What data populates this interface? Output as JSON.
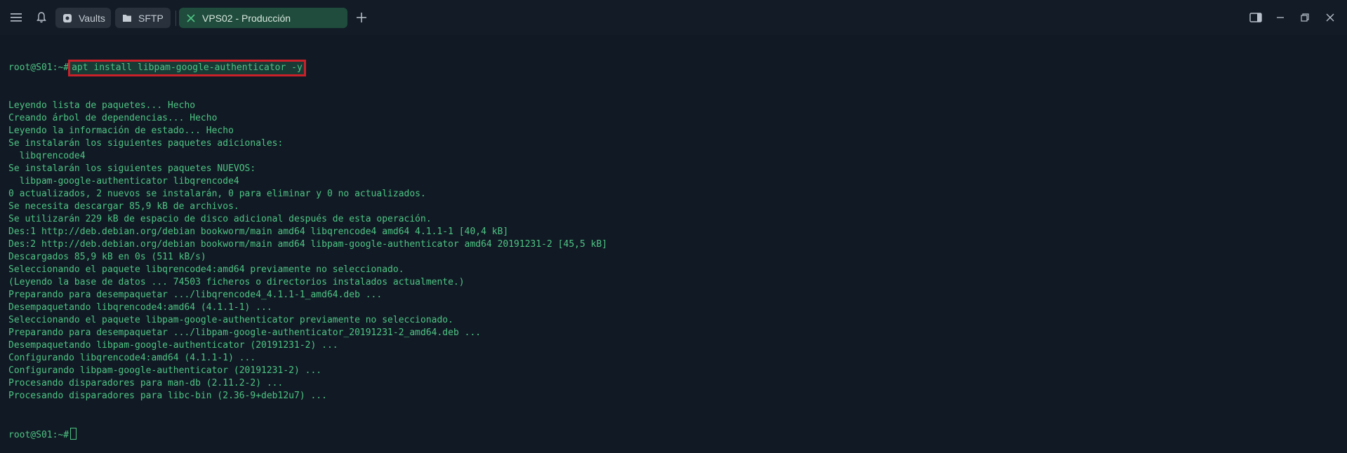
{
  "tabs": {
    "vaults": "Vaults",
    "sftp": "SFTP",
    "active": "VPS02 - Producción"
  },
  "terminal": {
    "prompt": "root@S01:~#",
    "command": "apt install libpam-google-authenticator -y",
    "output": [
      "Leyendo lista de paquetes... Hecho",
      "Creando árbol de dependencias... Hecho",
      "Leyendo la información de estado... Hecho",
      "Se instalarán los siguientes paquetes adicionales:",
      "  libqrencode4",
      "Se instalarán los siguientes paquetes NUEVOS:",
      "  libpam-google-authenticator libqrencode4",
      "0 actualizados, 2 nuevos se instalarán, 0 para eliminar y 0 no actualizados.",
      "Se necesita descargar 85,9 kB de archivos.",
      "Se utilizarán 229 kB de espacio de disco adicional después de esta operación.",
      "Des:1 http://deb.debian.org/debian bookworm/main amd64 libqrencode4 amd64 4.1.1-1 [40,4 kB]",
      "Des:2 http://deb.debian.org/debian bookworm/main amd64 libpam-google-authenticator amd64 20191231-2 [45,5 kB]",
      "Descargados 85,9 kB en 0s (511 kB/s)",
      "Seleccionando el paquete libqrencode4:amd64 previamente no seleccionado.",
      "(Leyendo la base de datos ... 74503 ficheros o directorios instalados actualmente.)",
      "Preparando para desempaquetar .../libqrencode4_4.1.1-1_amd64.deb ...",
      "Desempaquetando libqrencode4:amd64 (4.1.1-1) ...",
      "Seleccionando el paquete libpam-google-authenticator previamente no seleccionado.",
      "Preparando para desempaquetar .../libpam-google-authenticator_20191231-2_amd64.deb ...",
      "Desempaquetando libpam-google-authenticator (20191231-2) ...",
      "Configurando libqrencode4:amd64 (4.1.1-1) ...",
      "Configurando libpam-google-authenticator (20191231-2) ...",
      "Procesando disparadores para man-db (2.11.2-2) ...",
      "Procesando disparadores para libc-bin (2.36-9+deb12u7) ..."
    ]
  },
  "icons": {
    "menu": "menu-icon",
    "bell": "bell-icon",
    "vault": "vault-icon",
    "folder": "folder-icon",
    "terminal_status": "close-icon",
    "add": "plus-icon",
    "sidebar": "sidebar-toggle-icon",
    "minimize": "minimize-icon",
    "restore": "restore-icon",
    "close": "close-icon"
  },
  "colors": {
    "background": "#111a24",
    "terminal_text": "#4ec484",
    "active_tab": "#1f4c3c",
    "highlight_box": "#c9202a"
  }
}
